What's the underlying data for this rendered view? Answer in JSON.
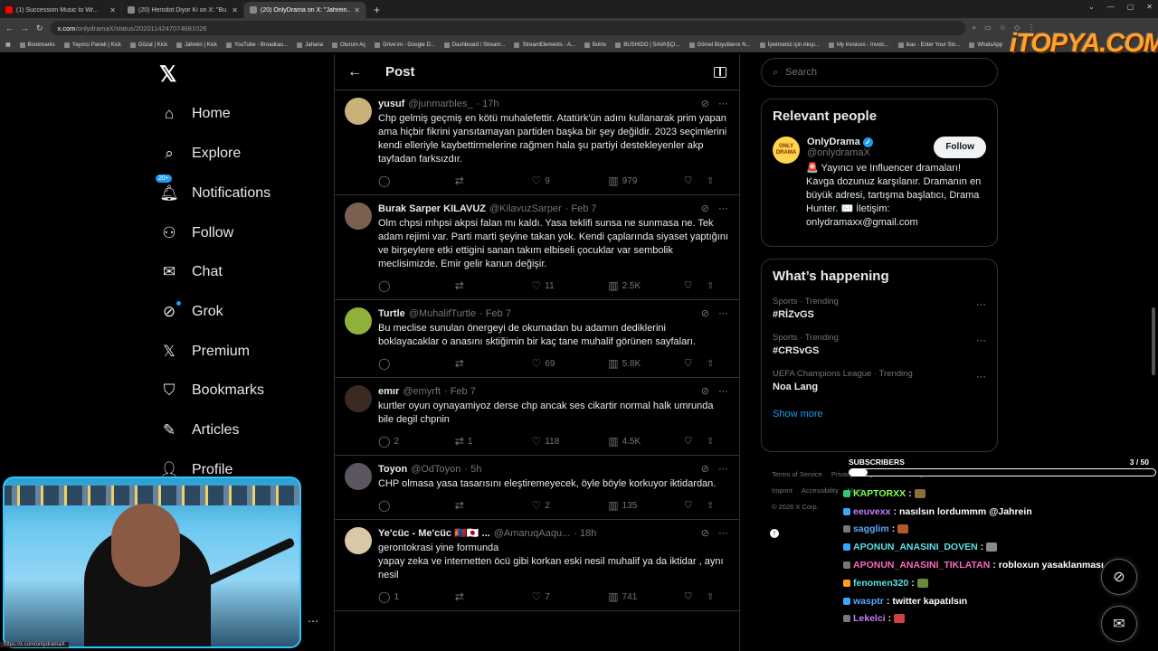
{
  "browser": {
    "tabs": [
      {
        "title": "(1) Succession Music to Wr...",
        "color": "#ff0000"
      },
      {
        "title": "(20) Herodot Diyor Ki on X: \"Bu...",
        "color": "#888888"
      },
      {
        "title": "(20) OnlyDrama on X: \"Jahrein...",
        "color": "#888888"
      }
    ],
    "url_host": "x.com",
    "url_path": "/onlydramaX/status/2020114247074681026",
    "bookmarks": [
      "Bookmarks",
      "Yayıncı Paneli | Kick",
      "Gözat | Kick",
      "Jahrein | Kick",
      "YouTube - Broadcas...",
      "Jaharia",
      "Oturum Aç",
      "Drive'ım - Google D...",
      "Dashboard / Stream...",
      "StreamElements - A...",
      "Botrix",
      "BUSHIDO | SAVAŞÇI...",
      "Görsel Boyutlarını N...",
      "İşletmeniz için Akışı...",
      "My Invoices - Invoic...",
      "ikas - Enter Your Sto...",
      "WhatsApp"
    ],
    "overlay_logo": "iTOPYA.COM",
    "status_url": "https://x.com/onlydramaX"
  },
  "nav": {
    "items": [
      {
        "label": "Home",
        "icon": "home-icon",
        "glyph": "⌂"
      },
      {
        "label": "Explore",
        "icon": "search-icon",
        "glyph": "⌕"
      },
      {
        "label": "Notifications",
        "icon": "bell-icon",
        "glyph": "🔔︎",
        "badge": "20+"
      },
      {
        "label": "Follow",
        "icon": "add-user-icon",
        "glyph": "⚇"
      },
      {
        "label": "Chat",
        "icon": "mail-icon",
        "glyph": "✉"
      },
      {
        "label": "Grok",
        "icon": "grok-icon",
        "glyph": "⊘"
      },
      {
        "label": "Premium",
        "icon": "x-premium-icon",
        "glyph": "𝕏"
      },
      {
        "label": "Bookmarks",
        "icon": "bookmark-icon",
        "glyph": "⛉"
      },
      {
        "label": "Articles",
        "icon": "article-icon",
        "glyph": "✎"
      },
      {
        "label": "Profile",
        "icon": "profile-icon",
        "glyph": "👤︎"
      }
    ]
  },
  "post": {
    "header_title": "Post",
    "replies": [
      {
        "name": "yusuf",
        "handle": "@junmarbles_",
        "time": "· 17h",
        "text": "Chp gelmiş geçmiş en kötü muhalefettir. Atatürk'ün adını kullanarak prim yapan ama hiçbir fikrini yansıtamayan partiden başka bir şey değildir. 2023 seçimlerini kendi elleriyle kaybettirmelerine rağmen hala şu partiyi destekleyenler akp tayfadan farksızdır.",
        "replies": "",
        "reposts": "",
        "likes": "9",
        "views": "979",
        "avatar": "#c8b27a"
      },
      {
        "name": "Burak Sarper KILAVUZ",
        "handle": "@KilavuzSarper",
        "time": "· Feb 7",
        "text": "Olm chpsi mhpsi akpsi falan mı kaldı. Yasa teklifi sunsa ne sunmasa ne. Tek adam rejimi var. Parti marti şeyine takan yok. Kendi çaplarında siyaset yaptığını ve birşeylere etki ettigini sanan takım elbiseli çocuklar var sembolik meclisimizde. Emir gelir kanun değişir.",
        "replies": "",
        "reposts": "",
        "likes": "11",
        "views": "2.5K",
        "avatar": "#7a6050"
      },
      {
        "name": "Turtle",
        "handle": "@MuhalifTurtle",
        "time": "· Feb 7",
        "text": "Bu meclise sunulan önergeyi de okumadan bu adamın dediklerini boklayacaklar o anasını sktiğimin bir kaç tane muhalif görünen sayfaları.",
        "replies": "",
        "reposts": "",
        "likes": "69",
        "views": "5.8K",
        "avatar": "#8fb03a"
      },
      {
        "name": "emır",
        "handle": "@emyrft",
        "time": "· Feb 7",
        "text": "kurtler oyun oynayamiyoz derse chp ancak ses cikartir normal halk umrunda bile degil chpnin",
        "replies": "2",
        "reposts": "1",
        "likes": "118",
        "views": "4.5K",
        "avatar": "#3a2a22"
      },
      {
        "name": "Toyon",
        "handle": "@OdToyon",
        "time": "· 5h",
        "text": "CHP olmasa yasa tasarısını eleştiremeyecek, öyle böyle korkuyor iktidardan.",
        "replies": "",
        "reposts": "",
        "likes": "2",
        "views": "135",
        "avatar": "#5a5560"
      },
      {
        "name": "Ye'cüc - Me'cüc 🇲🇳🇯🇵 ...",
        "handle": "@AmaruqAaqu...",
        "time": "· 18h",
        "text": "gerontokrasi yine formunda\nyapay zeka ve internetten öcü gibi korkan eski nesil muhalif ya da iktidar , aynı nesil",
        "replies": "1",
        "reposts": "",
        "likes": "7",
        "views": "741",
        "avatar": "#d8c8a8"
      }
    ]
  },
  "right": {
    "search_placeholder": "Search",
    "relevant_title": "Relevant people",
    "person": {
      "name": "OnlyDrama",
      "handle": "@onlydramaX",
      "follow_label": "Follow",
      "avatar_text": "ONLY DRAMA",
      "bio": "🚨 Yayıncı ve Influencer dramaları! Kavga dozunuz karşılanır. Dramanın en büyük adresi, tartışma başlatıcı, Drama Hunter. ✉️ İletişim: onlydramaxx@gmail.com"
    },
    "happening_title": "What’s happening",
    "trends": [
      {
        "meta": "Sports · Trending",
        "name": "#RİZvGS"
      },
      {
        "meta": "Sports · Trending",
        "name": "#CRSvGS"
      },
      {
        "meta": "UEFA Champions League · Trending",
        "name": "Noa Lang"
      }
    ],
    "show_more": "Show more",
    "footer": [
      "Terms of Service",
      "Privacy Policy",
      "Cookie Policy",
      "Imprint",
      "Accessibility",
      "More ...",
      "© 2026 X Corp."
    ]
  },
  "stream": {
    "subs_label": "SUBSCRIBERS",
    "subs_count": "3",
    "subs_goal": "/ 50",
    "subs_fraction": 0.06,
    "chat": [
      {
        "user": "KAPTORXX",
        "msg": "",
        "color": "#7dff4d",
        "badge": "#2ecc71",
        "emote": "#8b6d3a"
      },
      {
        "user": "eeuvexx",
        "msg": "nasılsın lordummm @Jahrein",
        "color": "#c77dff",
        "badge": "#3aa7ff"
      },
      {
        "user": "sagglim",
        "msg": "",
        "color": "#5aa7ff",
        "badge": "#777777",
        "emote": "#b05a2a"
      },
      {
        "user": "APONUN_ANASINI_DOVEN",
        "msg": "",
        "color": "#5ce1e6",
        "badge": "#3aa7ff",
        "emote": "#8a8a8a"
      },
      {
        "user": "APONUN_ANASINI_TIKLATAN",
        "msg": "robloxun yasaklanması clap",
        "color": "#ff66c4",
        "badge": "#777777"
      },
      {
        "user": "fenomen320",
        "msg": "",
        "color": "#5ce1e6",
        "badge": "#ff9f1c",
        "emote": "#6a8a3a"
      },
      {
        "user": "wasptr",
        "msg": "twitter kapatılsın",
        "color": "#5aa7ff",
        "badge": "#3aa7ff"
      },
      {
        "user": "Lekelci",
        "msg": "",
        "color": "#c77dff",
        "badge": "#777777",
        "emote": "#d04040"
      }
    ]
  }
}
